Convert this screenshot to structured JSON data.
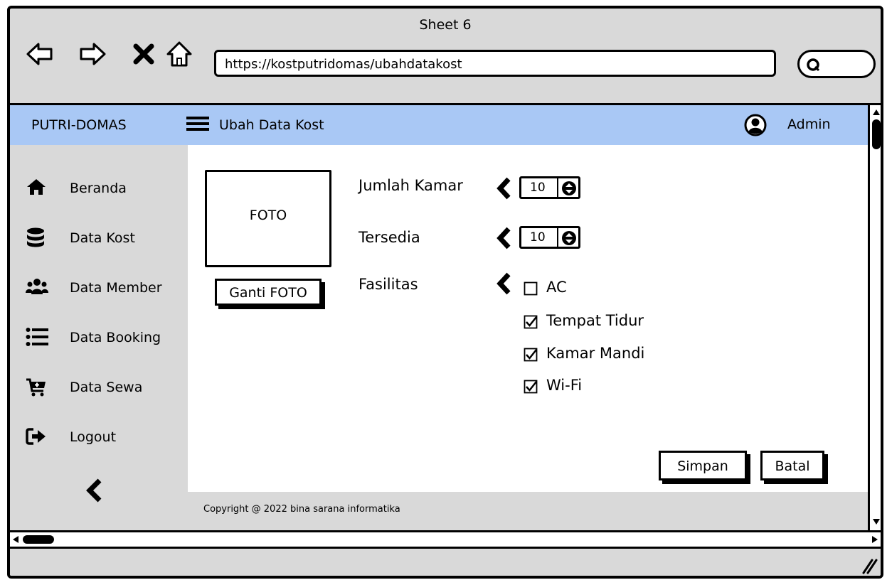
{
  "window": {
    "title": "Sheet 6"
  },
  "browser": {
    "url": "https://kostputridomas/ubahdatakost",
    "nav_icons": [
      "back-arrow-icon",
      "forward-arrow-icon",
      "close-icon",
      "home-icon"
    ],
    "search_icon": "search-icon"
  },
  "header": {
    "brand": "PUTRI-DOMAS",
    "menu_icon": "hamburger-menu-icon",
    "title": "Ubah Data Kost",
    "user_icon": "user-circle-icon",
    "user_name": "Admin",
    "background_color": "#a9c8f5"
  },
  "sidebar": {
    "items": [
      {
        "label": "Beranda",
        "icon": "home-icon"
      },
      {
        "label": "Data Kost",
        "icon": "database-icon"
      },
      {
        "label": "Data Member",
        "icon": "users-icon"
      },
      {
        "label": "Data Booking",
        "icon": "list-icon"
      },
      {
        "label": "Data Sewa",
        "icon": "cart-icon"
      },
      {
        "label": "Logout",
        "icon": "logout-icon"
      }
    ],
    "collapse_icon": "chevron-left-icon"
  },
  "form": {
    "photo_placeholder": "FOTO",
    "change_photo_label": "Ganti FOTO",
    "jumlah_kamar": {
      "label": "Jumlah Kamar",
      "value": "10"
    },
    "tersedia": {
      "label": "Tersedia",
      "value": "10"
    },
    "fasilitas": {
      "label": "Fasilitas",
      "options": [
        {
          "label": "AC",
          "checked": false
        },
        {
          "label": "Tempat Tidur",
          "checked": true
        },
        {
          "label": "Kamar Mandi",
          "checked": true
        },
        {
          "label": "Wi-Fi",
          "checked": true
        }
      ]
    },
    "save_label": "Simpan",
    "cancel_label": "Batal"
  },
  "footer": {
    "copyright": "Copyright @ 2022 bina sarana informatika"
  }
}
